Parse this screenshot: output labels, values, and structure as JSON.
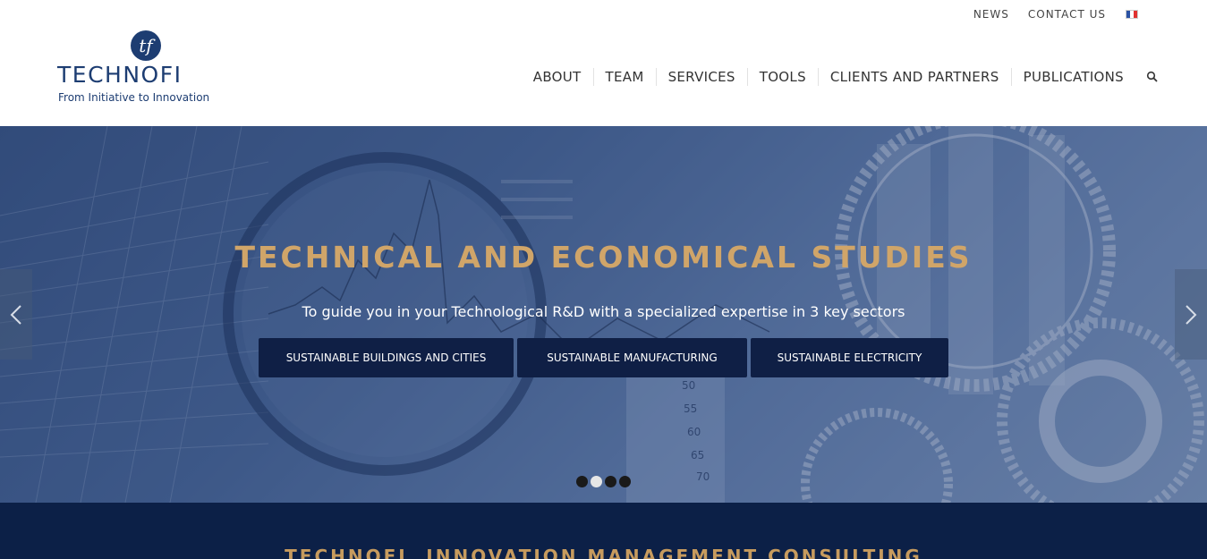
{
  "brand": {
    "name": "TECHNOFI",
    "tagline": "From Initiative to Innovation",
    "monogram": "tf",
    "color": "#1d3d72"
  },
  "topnav": {
    "items": [
      "NEWS",
      "CONTACT US"
    ],
    "language_flag": "flag-icon-france"
  },
  "mainnav": {
    "items": [
      "ABOUT",
      "TEAM",
      "SERVICES",
      "TOOLS",
      "CLIENTS AND PARTNERS",
      "PUBLICATIONS"
    ],
    "search_icon": "search-icon"
  },
  "hero": {
    "title": "TECHNICAL AND ECONOMICAL STUDIES",
    "subtitle": "To guide you in your Technological R&D with a specialized expertise in 3 key sectors",
    "buttons": [
      "SUSTAINABLE BUILDINGS AND CITIES",
      "SUSTAINABLE MANUFACTURING",
      "SUSTAINABLE ELECTRICITY"
    ],
    "prev_icon": "chevron-left-icon",
    "next_icon": "chevron-right-icon",
    "slide_count": 4,
    "active_slide": 2,
    "ruler_numbers": [
      "50",
      "55",
      "60",
      "65",
      "70"
    ],
    "title_color": "#d0a569",
    "button_color": "#0f1f45"
  },
  "section": {
    "title": "TECHNOFI, INNOVATION MANAGEMENT CONSULTING",
    "background": "#0c2047",
    "title_color": "#c79b5e"
  }
}
